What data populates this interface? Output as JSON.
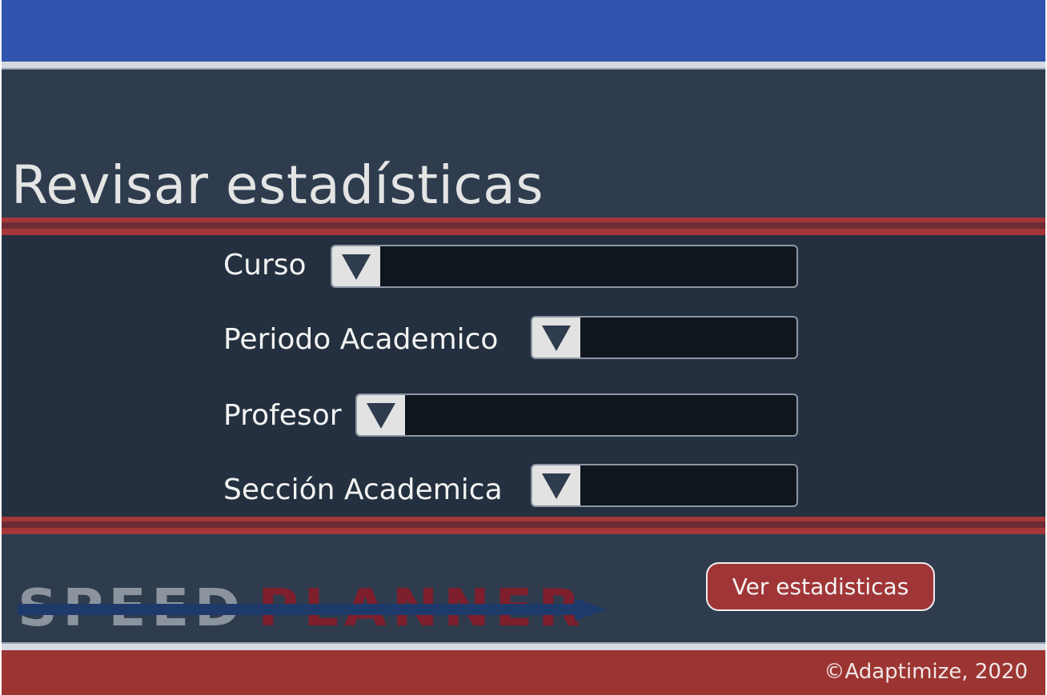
{
  "page": {
    "title": "Revisar estadísticas"
  },
  "form": {
    "fields": [
      {
        "label": "Curso",
        "value": ""
      },
      {
        "label": "Periodo Academico",
        "value": ""
      },
      {
        "label": "Profesor",
        "value": ""
      },
      {
        "label": "Sección Academica",
        "value": ""
      }
    ]
  },
  "actions": {
    "submit_label": "Ver estadisticas"
  },
  "logo": {
    "part1": "SPEED",
    "part2": "PLANNER"
  },
  "footer": {
    "copyright": "©Adaptimize, 2020"
  },
  "icons": {
    "dropdown": "triangle-down-icon"
  },
  "colors": {
    "header": "#3154ae",
    "accent_red": "#a03537",
    "panel": "#24303f",
    "background": "#2e3c4e"
  }
}
